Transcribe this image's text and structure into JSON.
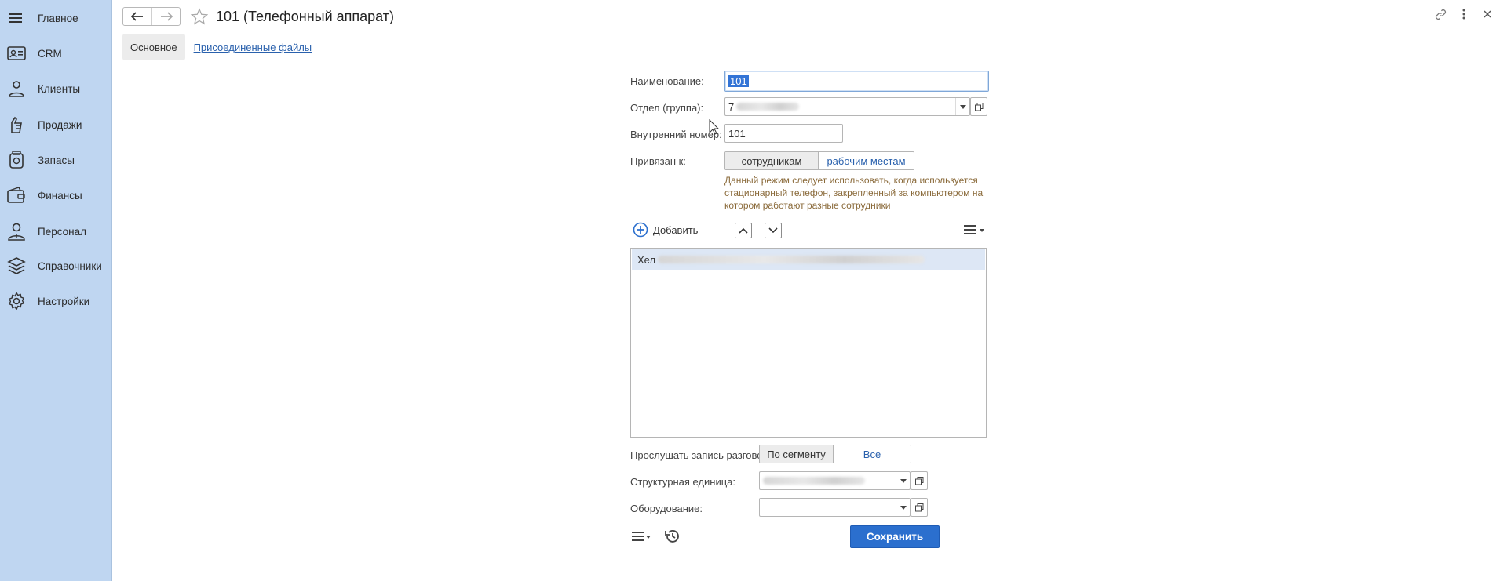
{
  "sidebar": {
    "items": [
      {
        "label": "Главное",
        "icon": "menu-icon"
      },
      {
        "label": "CRM",
        "icon": "contact-card-icon"
      },
      {
        "label": "Клиенты",
        "icon": "clients-icon"
      },
      {
        "label": "Продажи",
        "icon": "sales-icon"
      },
      {
        "label": "Запасы",
        "icon": "inventory-icon"
      },
      {
        "label": "Финансы",
        "icon": "wallet-icon"
      },
      {
        "label": "Персонал",
        "icon": "staff-icon"
      },
      {
        "label": "Справочники",
        "icon": "layers-icon"
      },
      {
        "label": "Настройки",
        "icon": "gear-icon"
      }
    ]
  },
  "header": {
    "title": "101 (Телефонный аппарат)"
  },
  "tabs": {
    "main": "Основное",
    "files": "Присоединенные файлы"
  },
  "form": {
    "name_label": "Наименование:",
    "name_value": "101",
    "dept_label": "Отдел (группа):",
    "dept_value": "7",
    "ext_label": "Внутренний номер:",
    "ext_value": "101",
    "bound_label": "Привязан к:",
    "bound_opt1": "сотрудникам",
    "bound_opt2": "рабочим местам",
    "note": "Данный режим следует использовать, когда используется стационарный телефон, закрепленный за компьютером на котором работают разные сотрудники",
    "add_label": "Добавить",
    "list_row": "Хел",
    "listen_label": "Прослушать запись разговоров:",
    "listen_opt1": "По сегменту",
    "listen_opt2": "Все",
    "struct_label": "Структурная единица:",
    "equip_label": "Оборудование:",
    "save_label": "Сохранить"
  },
  "colors": {
    "sidebar_bg": "#bfd6f1",
    "accent": "#2b6fce",
    "link": "#2a61ad",
    "note": "#8a6a3a"
  }
}
